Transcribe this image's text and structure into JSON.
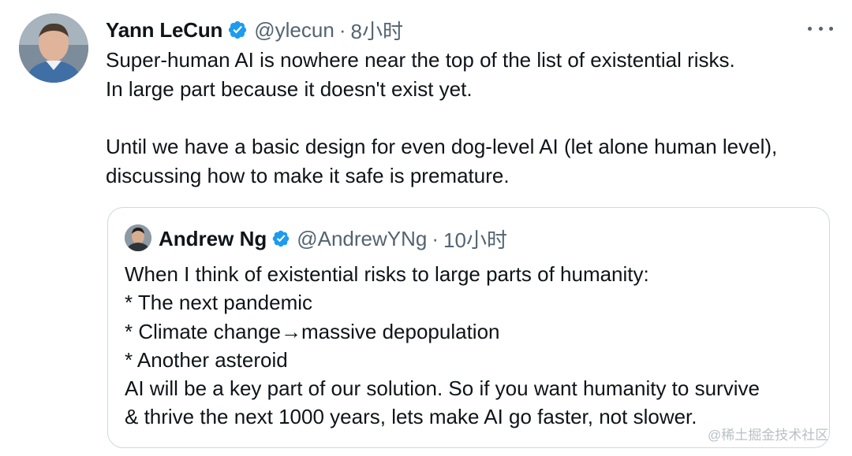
{
  "tweet": {
    "author_name": "Yann LeCun",
    "handle": "@ylecun",
    "separator": "·",
    "time": "8小时",
    "text_lines": [
      "Super-human AI is nowhere near the top of the list of existential risks.",
      "In large part because it doesn't exist yet.",
      "Until we have a basic design for even dog-level AI (let alone human level),",
      "discussing how to make it safe is premature."
    ]
  },
  "quote": {
    "author_name": "Andrew Ng",
    "handle": "@AndrewYNg",
    "separator": "·",
    "time": "10小时",
    "text_lines": [
      "When I think of existential risks to large parts of humanity:",
      "* The next pandemic",
      "* Climate change→massive depopulation",
      "* Another asteroid",
      "AI will be a key part of our solution. So if you want humanity to survive",
      "& thrive the next 1000 years, lets make AI go faster, not slower."
    ]
  },
  "watermark": "@稀土掘金技术社区",
  "icons": {
    "verified": "verified-badge-icon",
    "more": "more-options-icon"
  },
  "colors": {
    "verified": "#1d9bf0",
    "secondary_text": "#536471",
    "border": "#cfd9de"
  }
}
